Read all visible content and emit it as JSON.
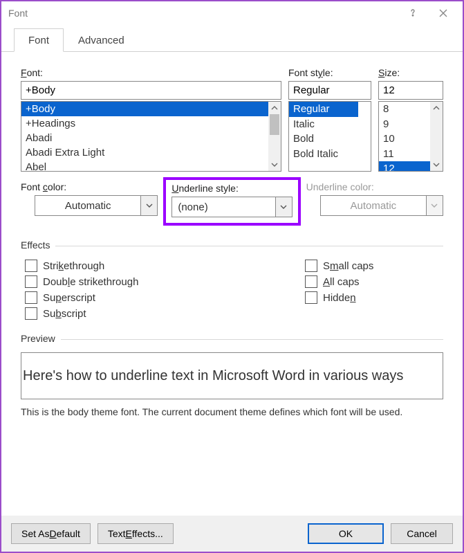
{
  "title": "Font",
  "tabs": {
    "font": "Font",
    "advanced": "Advanced"
  },
  "labels": {
    "font": "ont:",
    "font_pre": "F",
    "font_style": "Font st",
    "font_style_u": "y",
    "font_style_post": "le:",
    "size_u": "S",
    "size_post": "ize:",
    "font_color_pre": "Font ",
    "font_color_u": "c",
    "font_color_post": "olor:",
    "underline_style_u": "U",
    "underline_style_post": "nderline style:",
    "underline_color": "Underline color:",
    "effects": "Effects",
    "preview": "Preview"
  },
  "font_input": "+Body",
  "font_list": [
    "+Body",
    "+Headings",
    "Abadi",
    "Abadi Extra Light",
    "Abel"
  ],
  "font_selected_index": 0,
  "style_input": "Regular",
  "style_list": [
    "Regular",
    "Italic",
    "Bold",
    "Bold Italic"
  ],
  "style_selected_index": 0,
  "size_input": "12",
  "size_list": [
    "8",
    "9",
    "10",
    "11",
    "12"
  ],
  "size_selected_index": 4,
  "font_color": "Automatic",
  "underline_style": "(none)",
  "underline_color": "Automatic",
  "effects": {
    "strike_pre": "Stri",
    "strike_u": "k",
    "strike_post": "ethrough",
    "dstrike_pre": "Doub",
    "dstrike_u": "l",
    "dstrike_post": "e strikethrough",
    "super_pre": "Su",
    "super_u": "p",
    "super_post": "erscript",
    "sub_pre": "Su",
    "sub_u": "b",
    "sub_post": "script",
    "small_pre": "S",
    "small_u": "m",
    "small_post": "all caps",
    "all_u": "A",
    "all_post": "ll caps",
    "hidden_pre": "Hidde",
    "hidden_u": "n"
  },
  "preview_text": "Here's how to underline text in Microsoft Word in various ways",
  "preview_desc": "This is the body theme font. The current document theme defines which font will be used.",
  "buttons": {
    "default_pre": "Set As ",
    "default_u": "D",
    "default_post": "efault",
    "text_effects_pre": "Text ",
    "text_effects_u": "E",
    "text_effects_post": "ffects...",
    "ok": "OK",
    "cancel": "Cancel"
  }
}
